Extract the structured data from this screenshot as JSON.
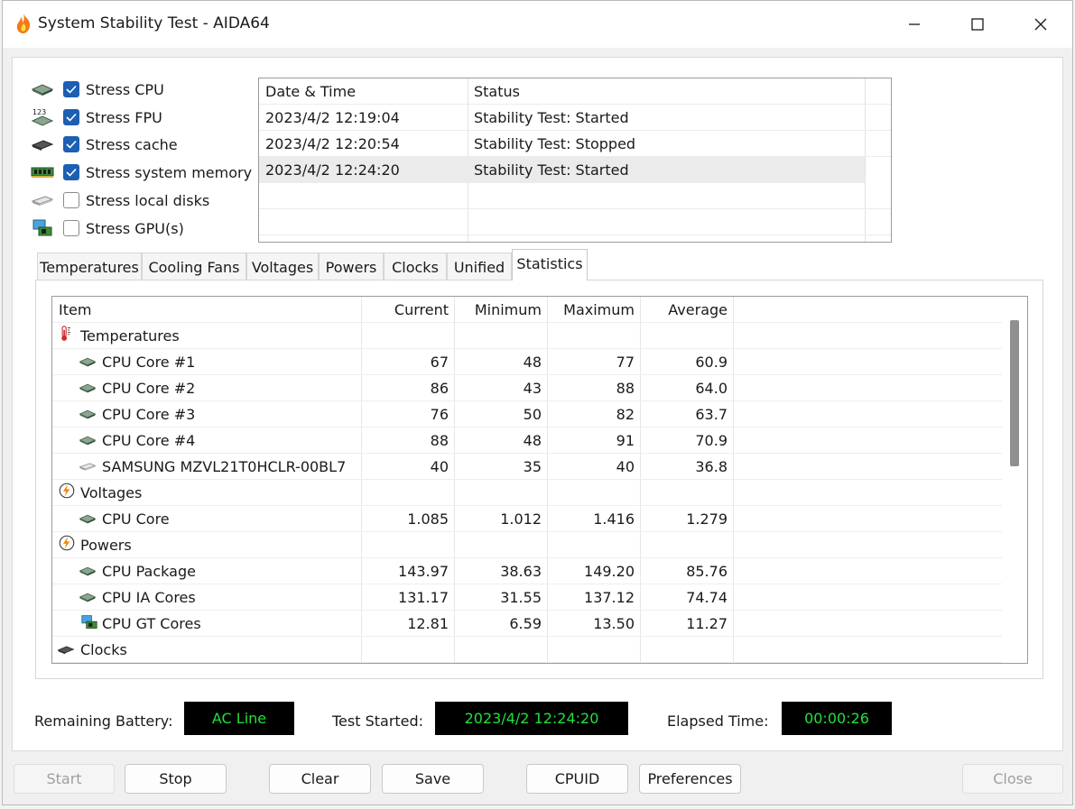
{
  "window": {
    "title": "System Stability Test - AIDA64"
  },
  "stress_options": [
    {
      "label": "Stress CPU",
      "checked": true,
      "icon": "cpu-chip-icon"
    },
    {
      "label": "Stress FPU",
      "checked": true,
      "icon": "fpu-123-icon"
    },
    {
      "label": "Stress cache",
      "checked": true,
      "icon": "cache-chip-icon"
    },
    {
      "label": "Stress system memory",
      "checked": true,
      "icon": "memory-module-icon"
    },
    {
      "label": "Stress local disks",
      "checked": false,
      "icon": "disk-drive-icon"
    },
    {
      "label": "Stress GPU(s)",
      "checked": false,
      "icon": "gpu-monitor-icon"
    }
  ],
  "log": {
    "headers": [
      "Date & Time",
      "Status"
    ],
    "rows": [
      {
        "time": "2023/4/2 12:19:04",
        "status": "Stability Test: Started"
      },
      {
        "time": "2023/4/2 12:20:54",
        "status": "Stability Test: Stopped"
      },
      {
        "time": "2023/4/2 12:24:20",
        "status": "Stability Test: Started",
        "selected": true
      }
    ]
  },
  "tabs": [
    "Temperatures",
    "Cooling Fans",
    "Voltages",
    "Powers",
    "Clocks",
    "Unified",
    "Statistics"
  ],
  "active_tab": "Statistics",
  "stats": {
    "headers": [
      "Item",
      "Current",
      "Minimum",
      "Maximum",
      "Average"
    ],
    "rows": [
      {
        "group": true,
        "label": "Temperatures",
        "icon": "thermometer-icon"
      },
      {
        "label": "CPU Core #1",
        "icon": "cpu-chip-icon",
        "cur": "67",
        "min": "48",
        "max": "77",
        "avg": "60.9"
      },
      {
        "label": "CPU Core #2",
        "icon": "cpu-chip-icon",
        "cur": "86",
        "min": "43",
        "max": "88",
        "avg": "64.0"
      },
      {
        "label": "CPU Core #3",
        "icon": "cpu-chip-icon",
        "cur": "76",
        "min": "50",
        "max": "82",
        "avg": "63.7"
      },
      {
        "label": "CPU Core #4",
        "icon": "cpu-chip-icon",
        "cur": "88",
        "min": "48",
        "max": "91",
        "avg": "70.9"
      },
      {
        "label": "SAMSUNG MZVL21T0HCLR-00BL7",
        "icon": "disk-drive-icon",
        "cur": "40",
        "min": "35",
        "max": "40",
        "avg": "36.8"
      },
      {
        "group": true,
        "label": "Voltages",
        "icon": "voltage-bolt-icon"
      },
      {
        "label": "CPU Core",
        "icon": "cpu-chip-icon",
        "cur": "1.085",
        "min": "1.012",
        "max": "1.416",
        "avg": "1.279"
      },
      {
        "group": true,
        "label": "Powers",
        "icon": "power-bolt-icon"
      },
      {
        "label": "CPU Package",
        "icon": "cpu-chip-icon",
        "cur": "143.97",
        "min": "38.63",
        "max": "149.20",
        "avg": "85.76"
      },
      {
        "label": "CPU IA Cores",
        "icon": "cpu-chip-icon",
        "cur": "131.17",
        "min": "31.55",
        "max": "137.12",
        "avg": "74.74"
      },
      {
        "label": "CPU GT Cores",
        "icon": "gpu-monitor-icon",
        "cur": "12.81",
        "min": "6.59",
        "max": "13.50",
        "avg": "11.27"
      },
      {
        "group": true,
        "label": "Clocks",
        "icon": "clock-chip-icon"
      }
    ]
  },
  "status": {
    "battery_label": "Remaining Battery:",
    "battery_value": "AC Line",
    "started_label": "Test Started:",
    "started_value": "2023/4/2 12:24:20",
    "elapsed_label": "Elapsed Time:",
    "elapsed_value": "00:00:26",
    "value_color": "#22e03a"
  },
  "buttons": {
    "start": "Start",
    "stop": "Stop",
    "clear": "Clear",
    "save": "Save",
    "cpuid": "CPUID",
    "preferences": "Preferences",
    "close": "Close"
  }
}
